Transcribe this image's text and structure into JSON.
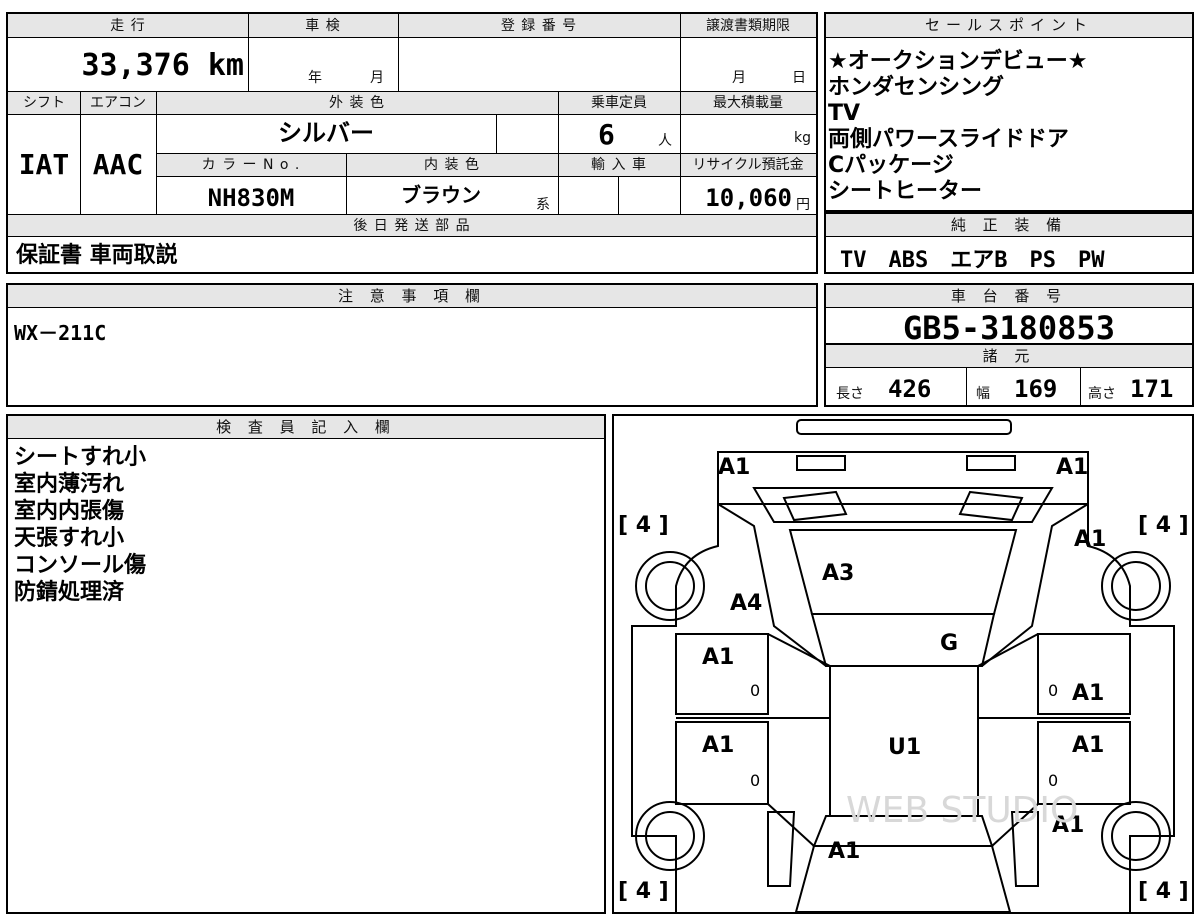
{
  "top_left": {
    "labels": {
      "mileage": "走 行",
      "inspection": "車 検",
      "registration": "登 録 番 号",
      "transfer_deadline": "譲渡書類期限",
      "shift": "シフト",
      "aircon": "エアコン",
      "exterior_color": "外 装 色",
      "capacity": "乗車定員",
      "max_load": "最大積載量",
      "color_no": "カ ラ ー N o .",
      "interior_color": "内 装 色",
      "import": "輸 入 車",
      "recycle": "リサイクル預託金",
      "later_parts": "後 日 発 送 部 品"
    },
    "mileage": "33,376 km",
    "inspection_year": "年",
    "inspection_month": "月",
    "deadline_month": "月",
    "deadline_day": "日",
    "shift": "IAT",
    "aircon": "AAC",
    "exterior_color": "シルバー",
    "capacity": "6",
    "capacity_unit": "人",
    "max_load_unit": "kg",
    "color_no": "NH830M",
    "interior_color": "ブラウン",
    "interior_suffix": "系",
    "recycle_fee": "10,060",
    "recycle_unit": "円",
    "later_parts": "保証書 車両取説"
  },
  "sales_points": {
    "header": "セールスポイント",
    "items": [
      "★オークションデビュー★",
      "ホンダセンシング",
      "TV",
      "両側パワースライドドア",
      "Cパッケージ",
      "シートヒーター"
    ]
  },
  "genuine_equipment": {
    "header": "純 正 装 備",
    "value": "TV　ABS　エアB　PS　PW"
  },
  "notes": {
    "header": "注 意 事 項 欄",
    "value": "WX－211C"
  },
  "chassis": {
    "header": "車 台 番 号",
    "value": "GB5-3180853"
  },
  "specs": {
    "header": "諸 元",
    "length_label": "長さ",
    "length": "426",
    "width_label": "幅",
    "width": "169",
    "height_label": "高さ",
    "height": "171"
  },
  "inspector": {
    "header": "検 査 員 記 入 欄",
    "lines": [
      "シートすれ小",
      "室内薄汚れ",
      "室内内張傷",
      "天張すれ小",
      "コンソール傷",
      "防錆処理済"
    ]
  },
  "diagram": {
    "tire_tl": "[ 4 ]",
    "tire_tr": "[ 4 ]",
    "tire_bl": "[ 4 ]",
    "tire_br": "[ 4 ]",
    "marks": {
      "front_left": "A1",
      "front_right": "A1",
      "right_fender": "A1",
      "hood": "A3",
      "left_fender": "A4",
      "windshield": "G",
      "left_front_door": "A1",
      "left_front_door_sub": "0",
      "right_front_door": "A1",
      "right_front_door_sub": "0",
      "roof": "U1",
      "left_rear_door": "A1",
      "left_rear_door_sub": "0",
      "right_rear_door": "A1",
      "right_rear_door_sub": "0",
      "right_quarter": "A1",
      "rear_glass": "A1"
    },
    "watermark": "WEB STUDIO"
  }
}
